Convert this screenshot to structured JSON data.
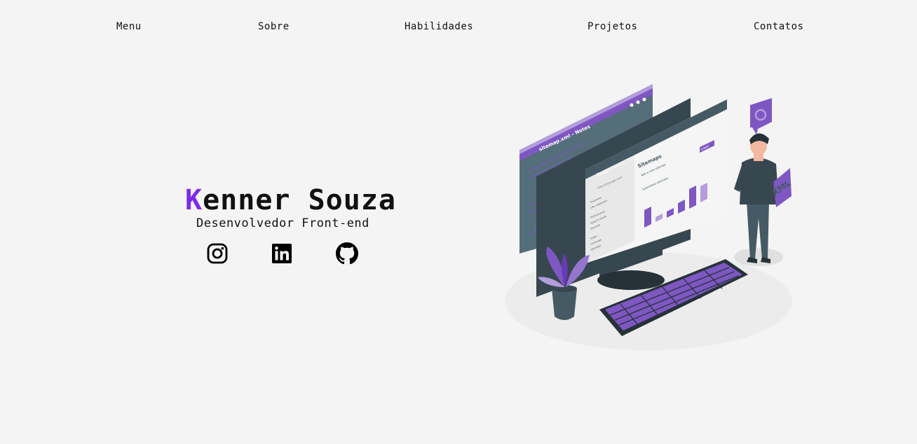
{
  "nav": {
    "items": [
      {
        "label": "Menu"
      },
      {
        "label": "Sobre"
      },
      {
        "label": "Habilidades"
      },
      {
        "label": "Projetos"
      },
      {
        "label": "Contatos"
      }
    ]
  },
  "hero": {
    "name_first_letter": "K",
    "name_rest": "enner Souza",
    "role": "Desenvolvedor Front-end",
    "accent_color": "#7d2ae8"
  },
  "social": {
    "icons": [
      "instagram-icon",
      "linkedin-icon",
      "github-icon"
    ]
  },
  "illustration": {
    "window_title": "sitemap.xml – Notes",
    "console_title": "Google Search Console",
    "url": "http://mypage.com",
    "panel_heading": "Sitemaps",
    "submit_label": "SUBMIT",
    "add_sitemap": "Add a new sitemap",
    "sitemap_file": "sitemap.xml",
    "submitted": "Submitted sitemaps",
    "sidebar_items": [
      "Overview",
      "URL inspection",
      "Performance",
      "Search results",
      "Discover",
      "Index",
      "Coverage",
      "Sitemaps"
    ],
    "badge_text": "XML",
    "colors": {
      "purple": "#7e57c2",
      "purple_light": "#b39ddb",
      "dark": "#455a64",
      "darker": "#37474f",
      "floor": "#ececec"
    }
  }
}
